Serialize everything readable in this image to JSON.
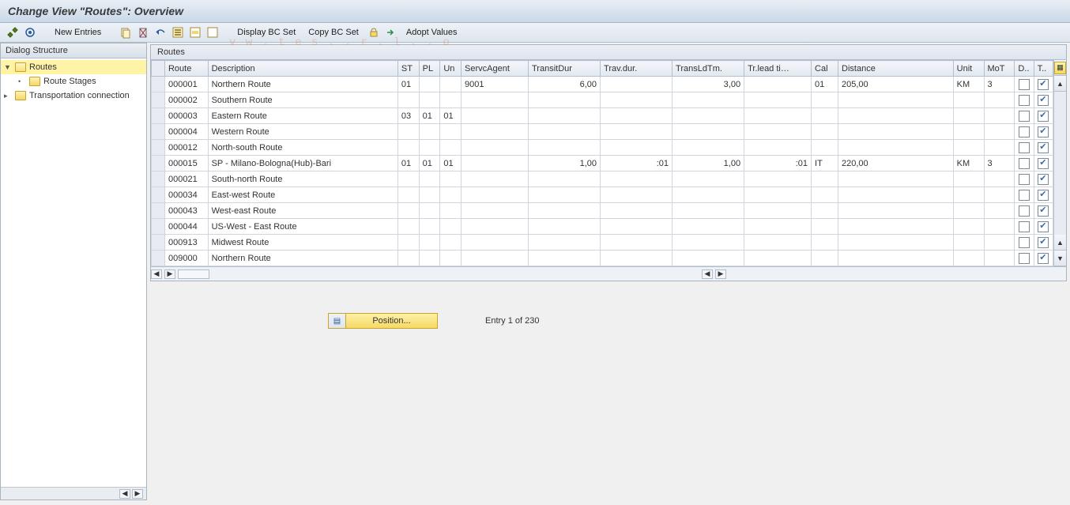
{
  "title": "Change View \"Routes\": Overview",
  "toolbar": {
    "new_entries": "New Entries",
    "display_bc": "Display BC Set",
    "copy_bc": "Copy BC Set",
    "adopt": "Adopt Values"
  },
  "left": {
    "header": "Dialog Structure",
    "nodes": {
      "routes": "Routes",
      "route_stages": "Route Stages",
      "transportation": "Transportation connection"
    }
  },
  "grid": {
    "title": "Routes",
    "cols": {
      "route": "Route",
      "description": "Description",
      "st": "ST",
      "pl": "PL",
      "un": "Un",
      "servc": "ServcAgent",
      "transitdur": "TransitDur",
      "travdur": "Trav.dur.",
      "transldtm": "TransLdTm.",
      "trlead": "Tr.lead ti…",
      "cal": "Cal",
      "distance": "Distance",
      "unit": "Unit",
      "mot": "MoT",
      "d": "D..",
      "t": "T.."
    },
    "rows": [
      {
        "route": "000001",
        "desc": "Northern Route",
        "st": "01",
        "pl": "",
        "un": "",
        "servc": "9001",
        "transit": "6,00",
        "trav": "",
        "transld": "3,00",
        "trlead": "",
        "cal": "01",
        "dist": "205,00",
        "unit": "KM",
        "mot": "3"
      },
      {
        "route": "000002",
        "desc": "Southern Route",
        "st": "",
        "pl": "",
        "un": "",
        "servc": "",
        "transit": "",
        "trav": "",
        "transld": "",
        "trlead": "",
        "cal": "",
        "dist": "",
        "unit": "",
        "mot": ""
      },
      {
        "route": "000003",
        "desc": "Eastern Route",
        "st": "03",
        "pl": "01",
        "un": "01",
        "servc": "",
        "transit": "",
        "trav": "",
        "transld": "",
        "trlead": "",
        "cal": "",
        "dist": "",
        "unit": "",
        "mot": ""
      },
      {
        "route": "000004",
        "desc": "Western Route",
        "st": "",
        "pl": "",
        "un": "",
        "servc": "",
        "transit": "",
        "trav": "",
        "transld": "",
        "trlead": "",
        "cal": "",
        "dist": "",
        "unit": "",
        "mot": ""
      },
      {
        "route": "000012",
        "desc": "North-south Route",
        "st": "",
        "pl": "",
        "un": "",
        "servc": "",
        "transit": "",
        "trav": "",
        "transld": "",
        "trlead": "",
        "cal": "",
        "dist": "",
        "unit": "",
        "mot": ""
      },
      {
        "route": "000015",
        "desc": "SP - Milano-Bologna(Hub)-Bari",
        "st": "01",
        "pl": "01",
        "un": "01",
        "servc": "",
        "transit": "1,00",
        "trav": ":01",
        "transld": "1,00",
        "trlead": ":01",
        "cal": "IT",
        "dist": "220,00",
        "unit": "KM",
        "mot": "3"
      },
      {
        "route": "000021",
        "desc": "South-north Route",
        "st": "",
        "pl": "",
        "un": "",
        "servc": "",
        "transit": "",
        "trav": "",
        "transld": "",
        "trlead": "",
        "cal": "",
        "dist": "",
        "unit": "",
        "mot": ""
      },
      {
        "route": "000034",
        "desc": "East-west Route",
        "st": "",
        "pl": "",
        "un": "",
        "servc": "",
        "transit": "",
        "trav": "",
        "transld": "",
        "trlead": "",
        "cal": "",
        "dist": "",
        "unit": "",
        "mot": ""
      },
      {
        "route": "000043",
        "desc": "West-east Route",
        "st": "",
        "pl": "",
        "un": "",
        "servc": "",
        "transit": "",
        "trav": "",
        "transld": "",
        "trlead": "",
        "cal": "",
        "dist": "",
        "unit": "",
        "mot": ""
      },
      {
        "route": "000044",
        "desc": "US-West - East Route",
        "st": "",
        "pl": "",
        "un": "",
        "servc": "",
        "transit": "",
        "trav": "",
        "transld": "",
        "trlead": "",
        "cal": "",
        "dist": "",
        "unit": "",
        "mot": ""
      },
      {
        "route": "000913",
        "desc": "Midwest Route",
        "st": "",
        "pl": "",
        "un": "",
        "servc": "",
        "transit": "",
        "trav": "",
        "transld": "",
        "trlead": "",
        "cal": "",
        "dist": "",
        "unit": "",
        "mot": ""
      },
      {
        "route": "009000",
        "desc": "Northern Route",
        "st": "",
        "pl": "",
        "un": "",
        "servc": "",
        "transit": "",
        "trav": "",
        "transld": "",
        "trlead": "",
        "cal": "",
        "dist": "",
        "unit": "",
        "mot": ""
      }
    ]
  },
  "footer": {
    "position": "Position...",
    "entry": "Entry 1 of 230"
  }
}
